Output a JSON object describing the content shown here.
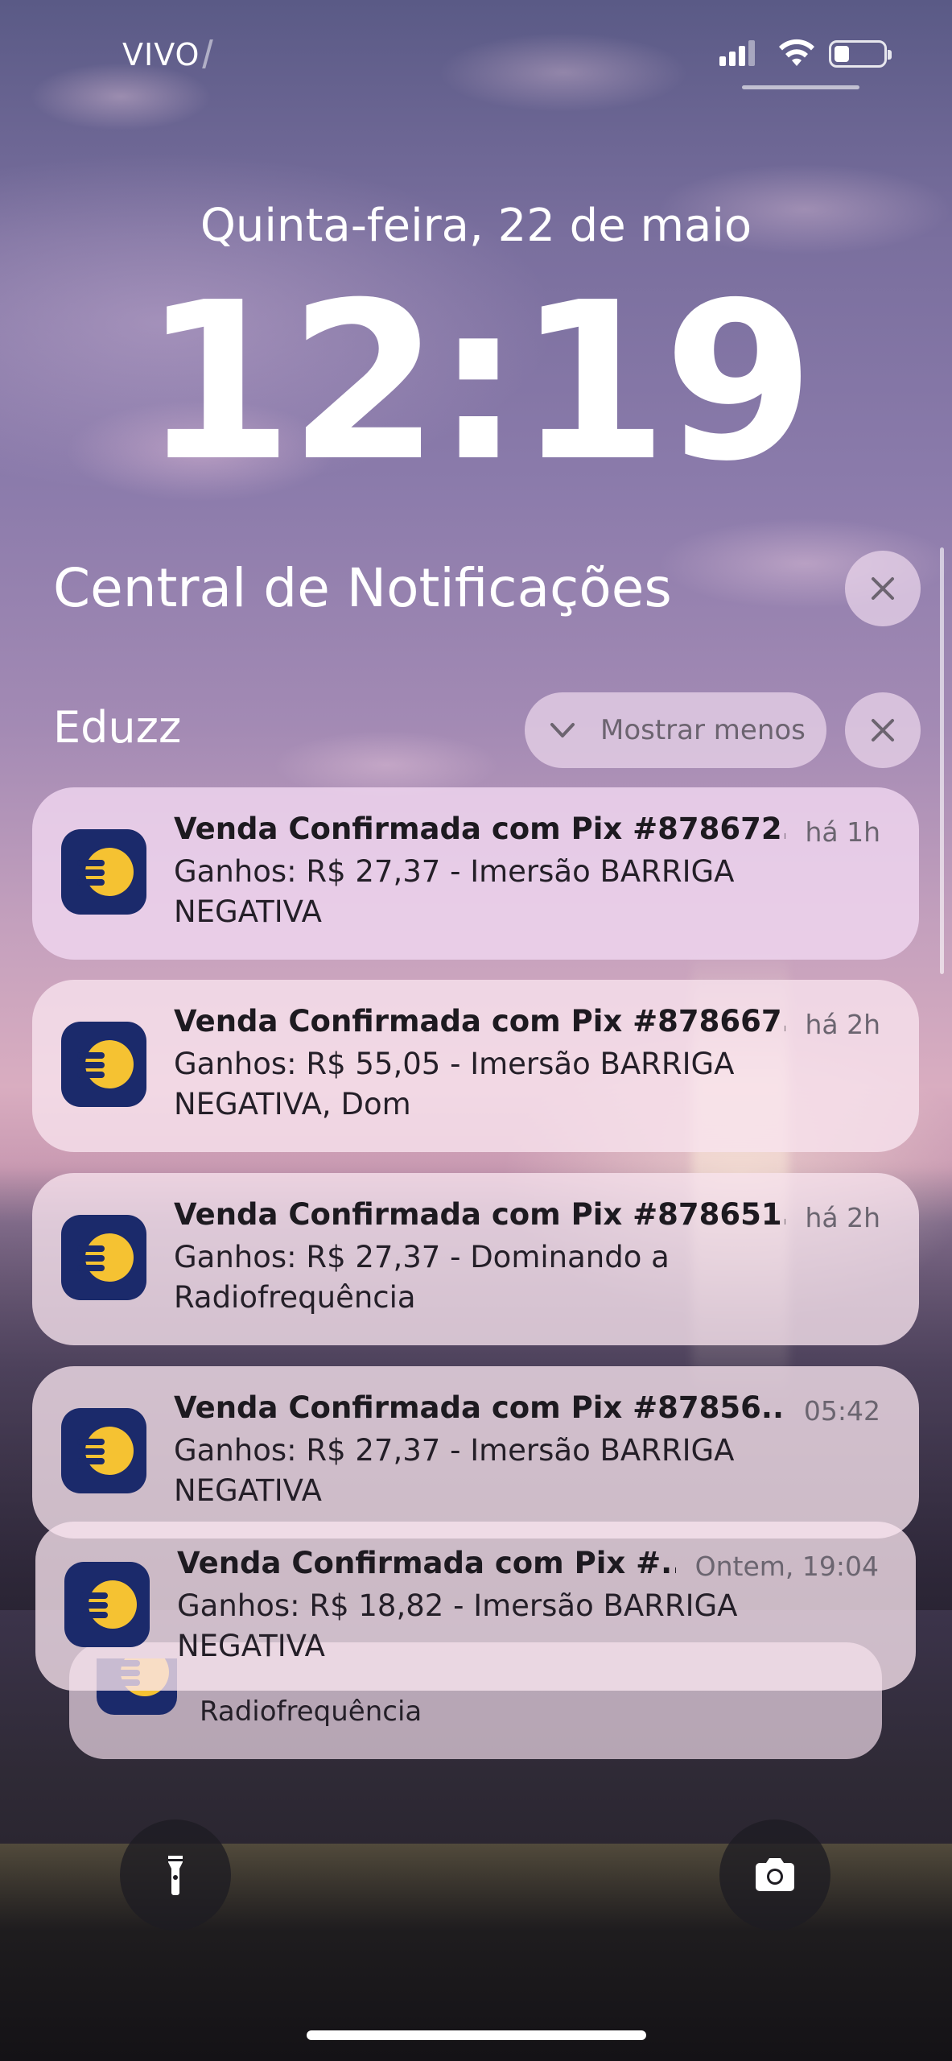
{
  "status_bar": {
    "carrier": "VIVO",
    "icons": [
      "signal-icon",
      "wifi-icon",
      "battery-icon"
    ],
    "battery_level": 0.25
  },
  "lock_screen": {
    "date": "Quinta-feira, 22 de maio",
    "time": "12:19"
  },
  "notification_center": {
    "title": "Central de Notificações",
    "group": {
      "app_name": "Eduzz",
      "show_less_label": "Mostrar menos",
      "notifications": [
        {
          "title": "Venda Confirmada com Pix #878672...",
          "time": "há 1h",
          "body": "Ganhos: R$ 27,37 - Imersão BARRIGA NEGATIVA"
        },
        {
          "title": "Venda Confirmada com Pix #878667...",
          "time": "há 2h",
          "body": "Ganhos: R$ 55,05 - Imersão BARRIGA NEGATIVA, Dom"
        },
        {
          "title": "Venda Confirmada com Pix #878651...",
          "time": "há 2h",
          "body": "Ganhos: R$ 27,37 - Dominando a Radiofrequência"
        },
        {
          "title": "Venda Confirmada com Pix #87856...",
          "time": "05:42",
          "body": "Ganhos: R$ 27,37 - Imersão BARRIGA NEGATIVA"
        },
        {
          "title": "Venda Confirmada com Pix #...",
          "time": "Ontem, 19:04",
          "body": "Ganhos: R$ 18,82 - Imersão BARRIGA NEGATIVA"
        }
      ],
      "stacked_peek_body": "Radiofrequência"
    }
  },
  "bottom_controls": {
    "left": "flashlight-icon",
    "right": "camera-icon"
  },
  "colors": {
    "app_icon_bg": "#1b2a6b",
    "app_icon_fg": "#f5c232"
  }
}
